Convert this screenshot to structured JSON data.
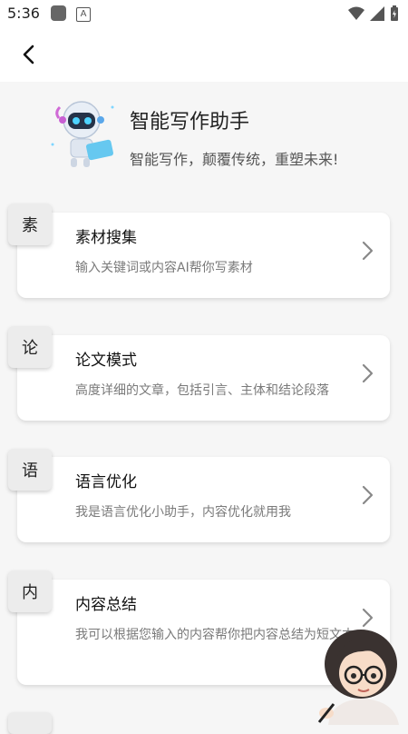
{
  "status": {
    "time": "5:36"
  },
  "header": {
    "title": "智能写作助手",
    "subtitle": "智能写作，颠覆传统，重塑未来!"
  },
  "items": [
    {
      "tag": "素",
      "title": "素材搜集",
      "desc": "输入关键词或内容AI帮你写素材"
    },
    {
      "tag": "论",
      "title": "论文模式",
      "desc": "高度详细的文章，包括引言、主体和结论段落"
    },
    {
      "tag": "语",
      "title": "语言优化",
      "desc": "我是语言优化小助手，内容优化就用我"
    },
    {
      "tag": "内",
      "title": "内容总结",
      "desc": "我可以根据您输入的内容帮你把内容总结为短文本"
    }
  ],
  "icons": {
    "back": "back-arrow-icon",
    "chevron": "chevron-right-icon",
    "robot": "robot-illustration",
    "girl": "girl-illustration"
  }
}
